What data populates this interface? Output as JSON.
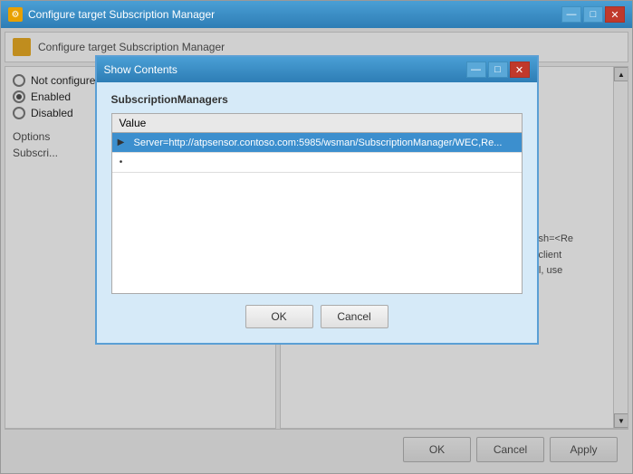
{
  "mainWindow": {
    "title": "Configure target Subscription Manager",
    "icon": "⚙"
  },
  "titleButtons": {
    "minimize": "—",
    "maximize": "□",
    "close": "✕"
  },
  "header": {
    "title": "Configure target Subscription Manager"
  },
  "radioOptions": {
    "not_configured": "Not configured",
    "enabled": "Enabled",
    "disabled": "Disabled"
  },
  "labels": {
    "options": "Options",
    "subscription": "Subscri..."
  },
  "rightPanelText": "e server address,\ny (CA) of a target\n\nfigure the Source\nqualified Domain\nspecifics.\n\nPS protocol:\n\nServer=https://<FQDN of the\ncollector>:5986/wsman/SubscriptionManager/WEC,Refresh=<Refresh interval in seconds>,IssuerCA=<Thumb print of the client authentication certificate>. When using the HTTP protocol, use",
  "dialog": {
    "title": "Show Contents",
    "minimizeBtn": "—",
    "restoreBtn": "□",
    "closeBtn": "✕",
    "sectionTitle": "SubscriptionManagers",
    "tableHeader": "Value",
    "selectedRow": "Server=http://atpsensor.contoso.com:5985/wsman/SubscriptionManager/WEC,Re...",
    "emptyRow": "",
    "okLabel": "OK",
    "cancelLabel": "Cancel"
  },
  "bottomBar": {
    "okLabel": "OK",
    "cancelLabel": "Cancel",
    "applyLabel": "Apply"
  }
}
